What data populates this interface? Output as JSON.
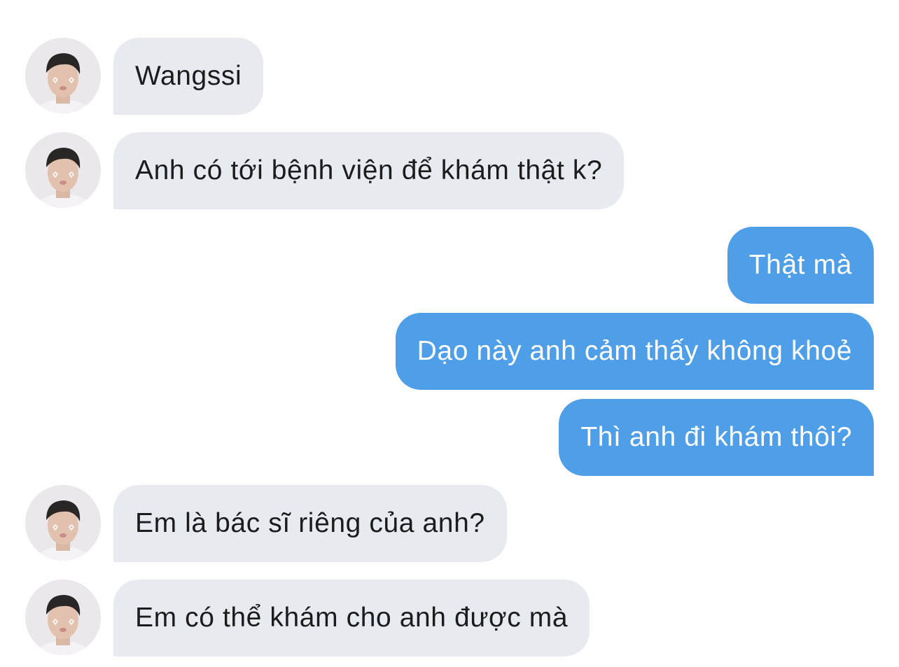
{
  "messages": [
    {
      "sender": "them",
      "text": "Wangssi",
      "avatar_icon": "profile-photo-icon"
    },
    {
      "sender": "them",
      "text": "Anh có tới bệnh viện để khám thật k?",
      "avatar_icon": "profile-photo-icon"
    },
    {
      "sender": "me",
      "text": "Thật mà"
    },
    {
      "sender": "me",
      "text": "Dạo này anh cảm thấy không khoẻ"
    },
    {
      "sender": "me",
      "text": "Thì anh đi khám thôi?"
    },
    {
      "sender": "them",
      "text": "Em là bác sĩ riêng của anh?",
      "avatar_icon": "profile-photo-icon"
    },
    {
      "sender": "them",
      "text": "Em có thể khám cho anh được mà",
      "avatar_icon": "profile-photo-icon"
    }
  ],
  "colors": {
    "incoming_bubble": "#e7ebf0",
    "outgoing_bubble": "#4f9fe8",
    "incoming_text": "#1c1c1e",
    "outgoing_text": "#ffffff",
    "background": "#ffffff"
  }
}
